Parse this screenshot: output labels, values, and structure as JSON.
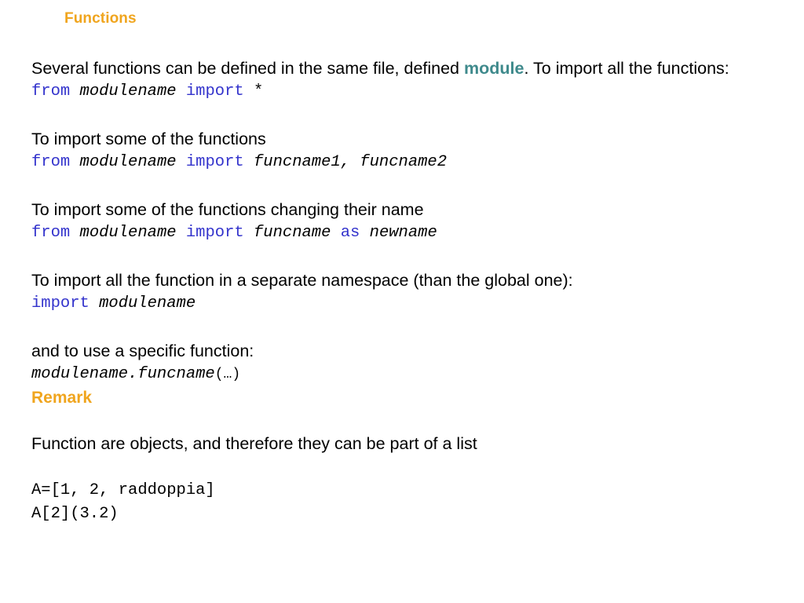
{
  "slide": {
    "title": "Functions",
    "colors": {
      "title_orange": "#F0A51E",
      "keyword_blue": "#3333CC",
      "module_teal": "#3F8A8C",
      "body_black": "#000000",
      "background": "#FFFFFF"
    },
    "blocks": {
      "intro": {
        "text_before": "Several functions can be defined in the same file, defined ",
        "highlight": "module",
        "text_after": ". To import all the functions:"
      },
      "code_import_all": {
        "kw_from": "from",
        "module": "modulename",
        "kw_import": "import",
        "star": "*"
      },
      "some_functions_label": "To import some of the functions",
      "code_import_some": {
        "kw_from": "from",
        "module": "modulename",
        "kw_import": "import",
        "names": "funcname1, funcname2"
      },
      "rename_label": "To import some of the functions changing their name",
      "code_import_as": {
        "kw_from": "from",
        "module": "modulename",
        "kw_import": "import",
        "func": "funcname",
        "kw_as": "as",
        "newname": "newname"
      },
      "namespace_label": "To import all the function in a separate namespace (than the global one):",
      "code_import_module": {
        "kw_import": "import",
        "module": "modulename"
      },
      "specific_label": "and to use a specific function:",
      "code_qualified_call": {
        "qualified": "modulename.funcname",
        "args": "(…)"
      },
      "remark_heading": "Remark",
      "objects_label": "Function are objects, and therefore they can be part of a list",
      "code_list": {
        "line1": "A=[1, 2, raddoppia]",
        "line2": "A[2](3.2)"
      }
    }
  }
}
